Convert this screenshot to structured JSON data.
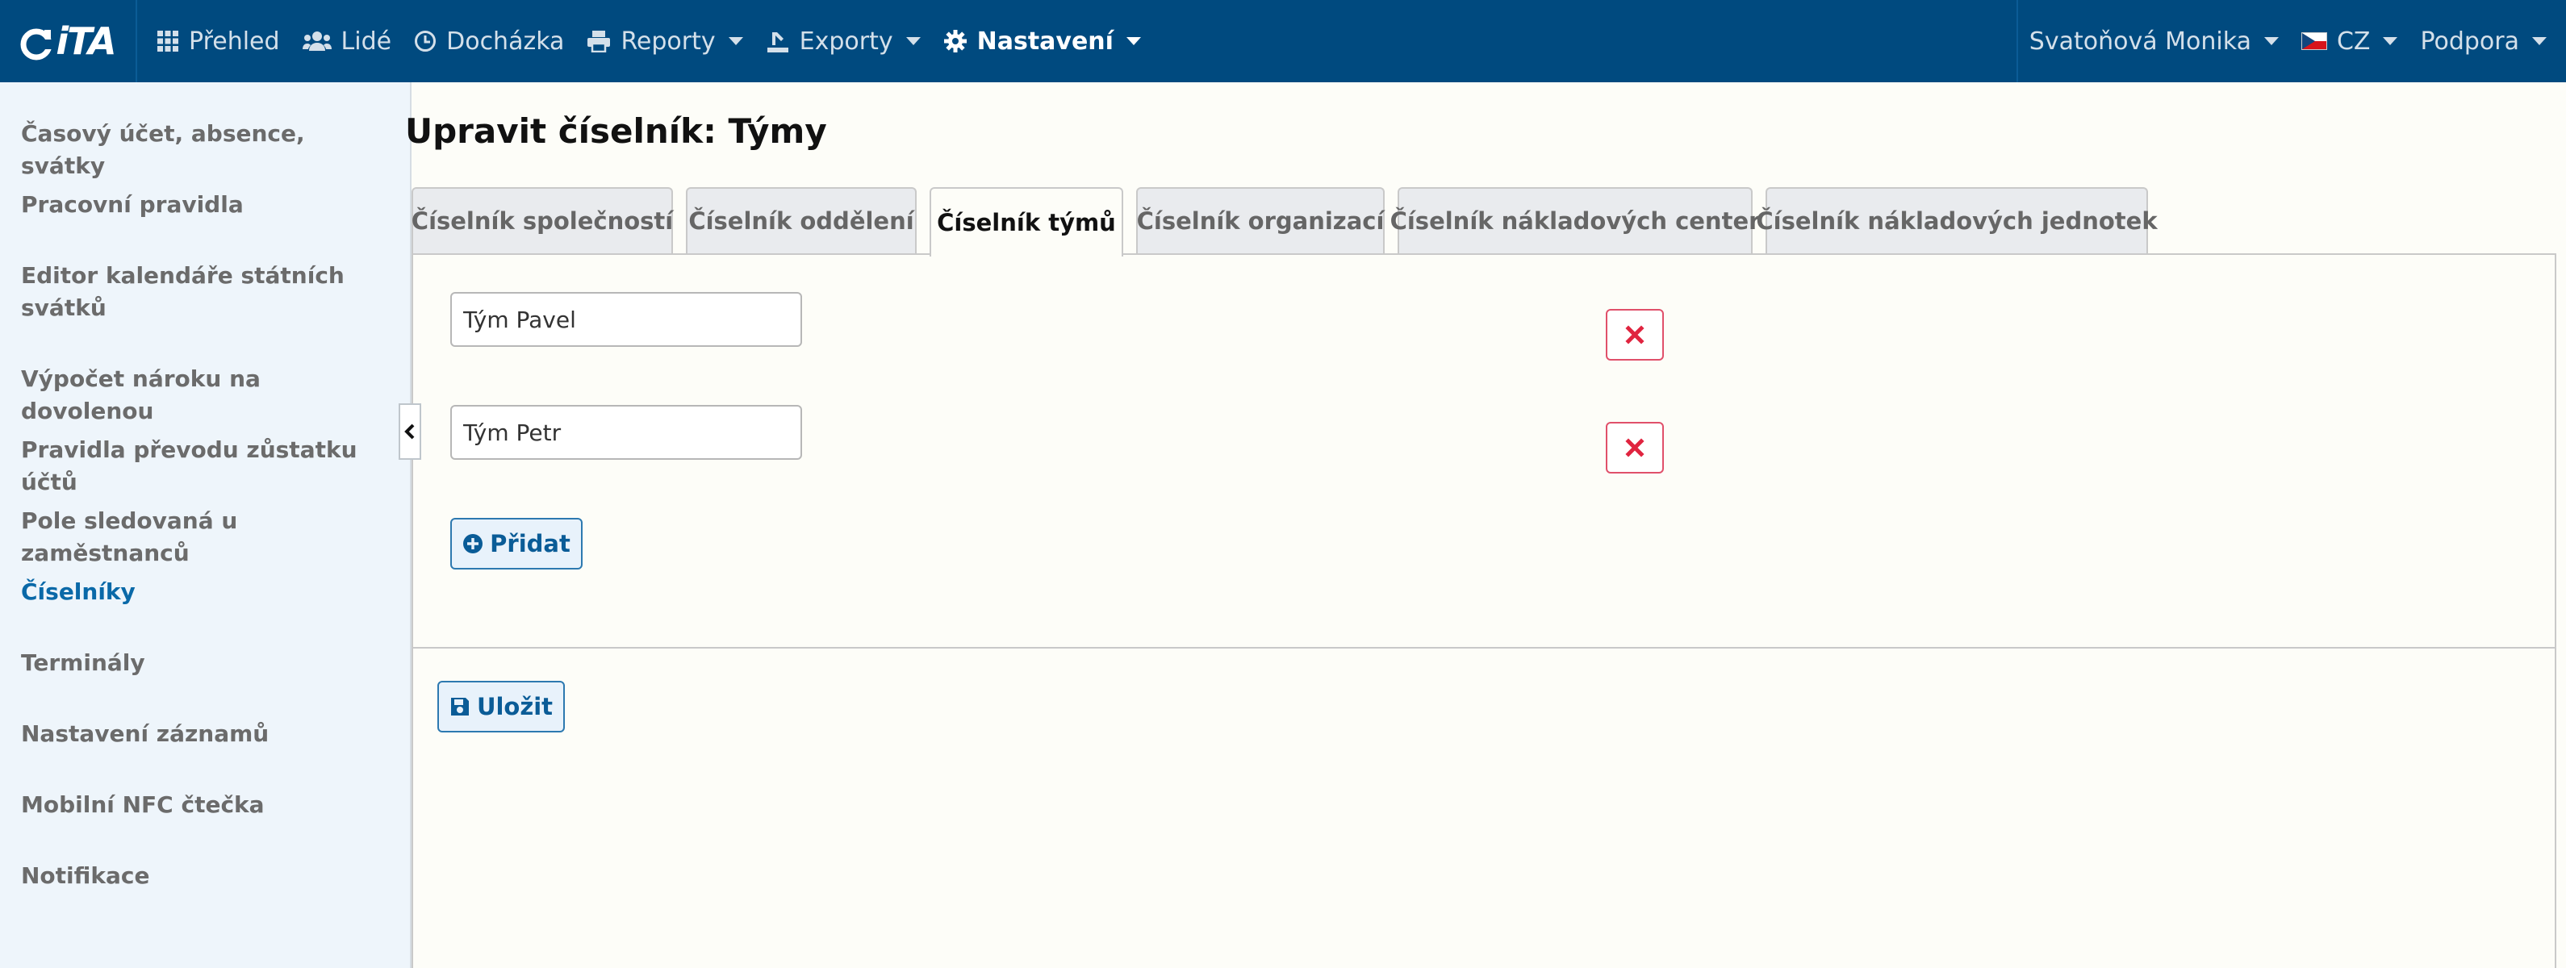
{
  "nav": {
    "logo": "iTA",
    "items": [
      {
        "label": "Přehled",
        "icon": "grid-icon"
      },
      {
        "label": "Lidé",
        "icon": "users-icon"
      },
      {
        "label": "Docházka",
        "icon": "clock-icon"
      },
      {
        "label": "Reporty",
        "icon": "printer-icon"
      },
      {
        "label": "Exporty",
        "icon": "export-icon"
      },
      {
        "label": "Nastavení",
        "icon": "gear-icon"
      }
    ],
    "user": "Svatoňová Monika",
    "language": "CZ",
    "support": "Podpora"
  },
  "sidebar": {
    "items": [
      {
        "label": "Časový účet, absence, svátky"
      },
      {
        "label": "Pracovní pravidla"
      },
      {
        "label": "Editor kalendáře státních svátků"
      },
      {
        "label": "Výpočet nároku na dovolenou"
      },
      {
        "label": "Pravidla převodu zůstatku účtů"
      },
      {
        "label": "Pole sledovaná u zaměstnanců"
      },
      {
        "label": "Číselníky"
      },
      {
        "label": "Terminály"
      },
      {
        "label": "Nastavení záznamů"
      },
      {
        "label": "Mobilní NFC čtečka"
      },
      {
        "label": "Notifikace"
      }
    ],
    "active_index": 6
  },
  "main": {
    "title": "Upravit číselník: Týmy",
    "tabs": [
      {
        "label": "Číselník společností"
      },
      {
        "label": "Číselník oddělení"
      },
      {
        "label": "Číselník týmů"
      },
      {
        "label": "Číselník organizací"
      },
      {
        "label": "Číselník nákladových center"
      },
      {
        "label": "Číselník nákladových jednotek"
      }
    ],
    "active_tab": 2,
    "entries": [
      {
        "value": "Tým Pavel"
      },
      {
        "value": "Tým Petr"
      }
    ],
    "add_label": "Přidat",
    "save_label": "Uložit"
  },
  "colors": {
    "navbar": "#004a7f",
    "accent": "#0a69a8",
    "danger": "#e0243f"
  }
}
